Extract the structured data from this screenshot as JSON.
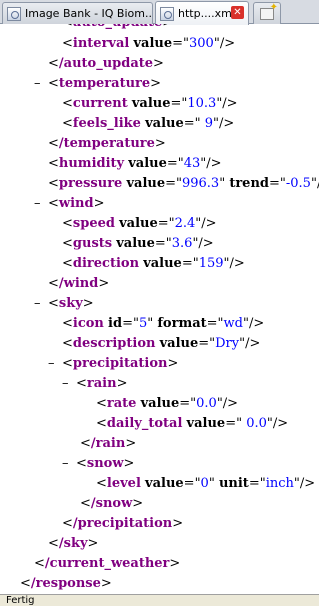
{
  "tabs": [
    {
      "label": "Image Bank - IQ Biom..."
    },
    {
      "label": "http....xml"
    }
  ],
  "status": "Fertig",
  "xml": {
    "l0": {
      "tag": "auto_update"
    },
    "l1": {
      "tag": "interval",
      "attr": "value",
      "val": "300"
    },
    "l2": {
      "tag": "/auto_update"
    },
    "l3": {
      "tag": "temperature"
    },
    "l4": {
      "tag": "current",
      "attr": "value",
      "val": "10.3"
    },
    "l5": {
      "tag": "feels_like",
      "attr": "value",
      "val": " 9"
    },
    "l6": {
      "tag": "/temperature"
    },
    "l7": {
      "tag": "humidity",
      "attr": "value",
      "val": "43"
    },
    "l8": {
      "tag": "pressure",
      "attr": "value",
      "val": "996.3",
      "attr2": "trend",
      "val2": "-0.5"
    },
    "l9": {
      "tag": "wind"
    },
    "l10": {
      "tag": "speed",
      "attr": "value",
      "val": "2.4"
    },
    "l11": {
      "tag": "gusts",
      "attr": "value",
      "val": "3.6"
    },
    "l12": {
      "tag": "direction",
      "attr": "value",
      "val": "159"
    },
    "l13": {
      "tag": "/wind"
    },
    "l14": {
      "tag": "sky"
    },
    "l15": {
      "tag": "icon",
      "attr": "id",
      "val": "5",
      "attr2": "format",
      "val2": "wd"
    },
    "l16": {
      "tag": "description",
      "attr": "value",
      "val": "Dry"
    },
    "l17": {
      "tag": "precipitation"
    },
    "l18": {
      "tag": "rain"
    },
    "l19": {
      "tag": "rate",
      "attr": "value",
      "val": "0.0"
    },
    "l20": {
      "tag": "daily_total",
      "attr": "value",
      "val": " 0.0"
    },
    "l21": {
      "tag": "/rain"
    },
    "l22": {
      "tag": "snow"
    },
    "l23": {
      "tag": "level",
      "attr": "value",
      "val": "0",
      "attr2": "unit",
      "val2": "inch"
    },
    "l24": {
      "tag": "/snow"
    },
    "l25": {
      "tag": "/precipitation"
    },
    "l26": {
      "tag": "/sky"
    },
    "l27": {
      "tag": "/current_weather"
    },
    "l28": {
      "tag": "/response"
    }
  },
  "colors": {
    "tag": "#800080",
    "value": "#0000ff",
    "text": "#000000"
  }
}
